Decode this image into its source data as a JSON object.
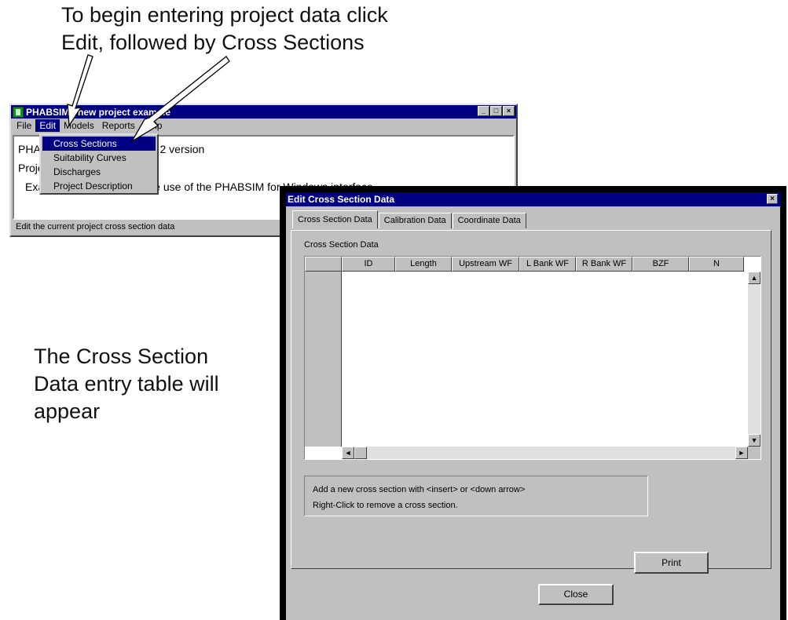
{
  "instruction": {
    "line1": "To begin entering project data click",
    "line2": "Edit, followed by Cross Sections"
  },
  "result_note": {
    "line1": "The Cross Section",
    "line2": "Data entry table will",
    "line3": "appear"
  },
  "main_window": {
    "title": "PHABSIM - new project example",
    "menu": [
      "File",
      "Edit",
      "Models",
      "Reports",
      "Help"
    ],
    "content": {
      "line1": "PHABSIM for Windows Beta 2 version",
      "line2": "Project",
      "line3": "Example project to illustrate use of the PHABSIM for Windows interface"
    },
    "status": "Edit the current project cross section data",
    "title_buttons": [
      "_",
      "□",
      "×"
    ]
  },
  "edit_menu": {
    "items": [
      "Cross Sections",
      "Suitability Curves",
      "Discharges",
      "Project Description"
    ],
    "selected": "Cross Sections"
  },
  "dialog": {
    "title": "Edit Cross Section Data",
    "tabs": [
      "Cross Section Data",
      "Calibration Data",
      "Coordinate Data"
    ],
    "active_tab": "Cross Section Data",
    "group_label": "Cross Section Data",
    "columns": [
      "",
      "ID",
      "Length",
      "Upstream WF",
      "L Bank WF",
      "R Bank WF",
      "BZF",
      "N"
    ],
    "hint_line1": "Add a new cross section with <insert> or <down arrow>",
    "hint_line2": "Right-Click to remove a cross section.",
    "print_label": "Print",
    "close_label": "Close",
    "close_x": "×"
  },
  "colors": {
    "titlebar": "#000080",
    "face": "#c0c0c0",
    "highlight": "#000080"
  }
}
